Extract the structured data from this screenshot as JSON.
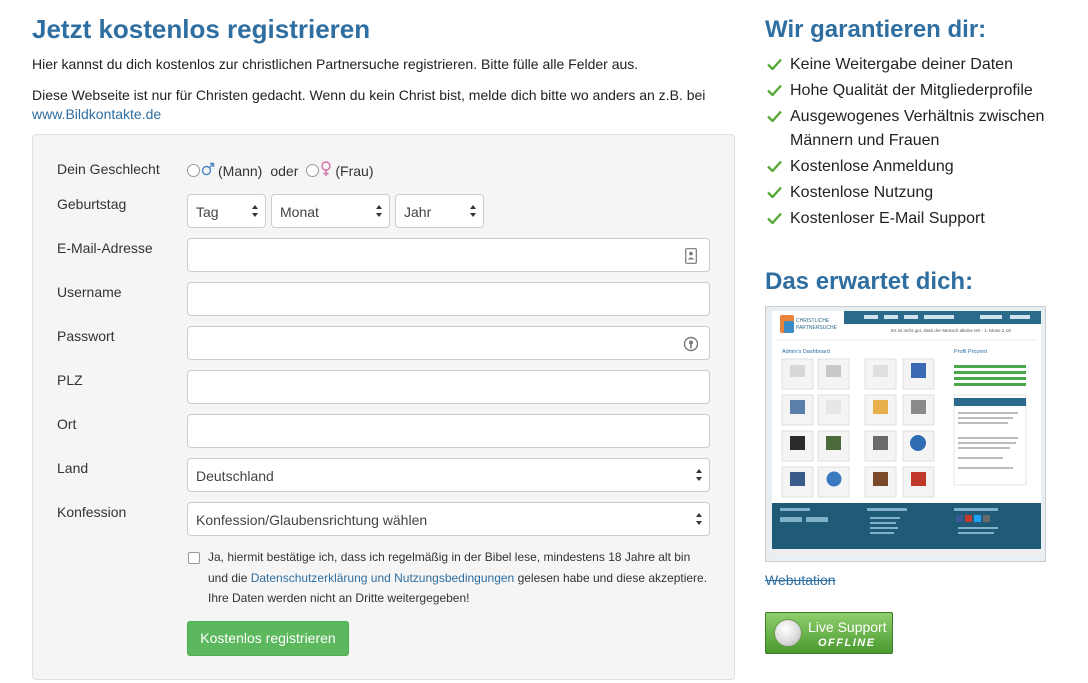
{
  "registration": {
    "title": "Jetzt kostenlos registrieren",
    "intro_line1": "Hier kannst du dich kostenlos zur christlichen Partnersuche registrieren. Bitte fülle alle Felder aus.",
    "intro_line2": "Diese Webseite ist nur für Christen gedacht. Wenn du kein Christ bist, melde dich bitte wo anders an z.B. bei",
    "intro_link": "www.Bildkontakte.de"
  },
  "form": {
    "gender_label": "Dein Geschlecht",
    "gender_male": "(Mann)",
    "gender_or": "oder",
    "gender_female": "(Frau)",
    "birthday_label": "Geburtstag",
    "birthday_day": "Tag",
    "birthday_month": "Monat",
    "birthday_year": "Jahr",
    "email_label": "E-Mail-Adresse",
    "username_label": "Username",
    "password_label": "Passwort",
    "plz_label": "PLZ",
    "ort_label": "Ort",
    "land_label": "Land",
    "land_value": "Deutschland",
    "confession_label": "Konfession",
    "confession_value": "Konfession/Glaubensrichtung wählen",
    "consent_text_1": "Ja, hiermit bestätige ich, dass ich regelmäßig in der Bibel lese, mindestens 18 Jahre alt bin und die ",
    "consent_link": "Datenschutzerklärung und Nutzungsbedingungen",
    "consent_text_2": " gelesen habe und diese akzeptiere. Ihre Daten werden nicht an Dritte weitergegeben!",
    "submit_label": "Kostenlos registrieren"
  },
  "guarantee": {
    "title": "Wir garantieren dir:",
    "items": [
      "Keine Weitergabe deiner Daten",
      "Hohe Qualität der Mitgliederprofile",
      "Ausgewogenes Verhältnis zwischen Männern und Frauen",
      "Kostenlose Anmeldung",
      "Kostenlose Nutzung",
      "Kostenloser E-Mail Support"
    ]
  },
  "expect": {
    "title": "Das erwartet dich:",
    "preview": {
      "logo_line1": "CHRISTLICHE",
      "logo_line2": "PARTNERSUCHE",
      "quote": "Es ist nicht gut, dass der Mensch alleine ist! - 1. Mose 2,18",
      "dashboard_title": "Admin's Dashboard",
      "profile_title": "Profil Prozent"
    }
  },
  "webutation_label": "Webutation",
  "live_support": {
    "line1": "Live Support",
    "line2": "OFFLINE"
  },
  "colors": {
    "heading": "#2f6ea0",
    "link": "#2f6ea0",
    "check": "#5aa83a",
    "button": "#5cb85c",
    "panel": "#f5f5f5"
  }
}
